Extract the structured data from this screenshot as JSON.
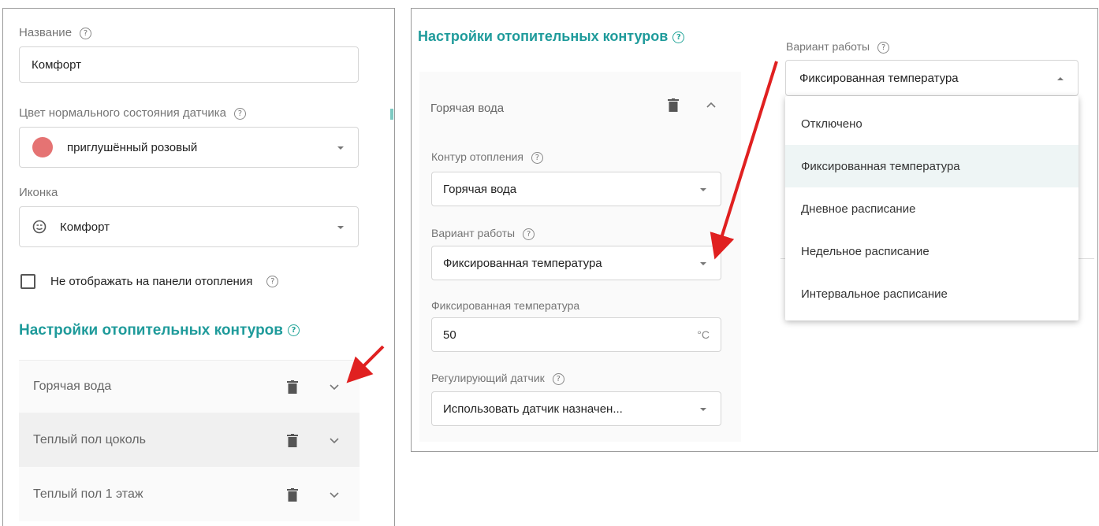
{
  "left": {
    "name_label": "Название",
    "name_value": "Комфорт",
    "color_label": "Цвет нормального состояния датчика",
    "color_value": "приглушённый розовый",
    "color_swatch": "#e57373",
    "icon_label": "Иконка",
    "icon_name": "smiley-icon",
    "icon_value": "Комфорт",
    "checkbox_label": "Не отображать на панели отопления",
    "section_title": "Настройки отопительных контуров",
    "circuits": [
      {
        "label": "Горячая вода"
      },
      {
        "label": "Теплый пол цоколь"
      },
      {
        "label": "Теплый пол 1 этаж"
      }
    ]
  },
  "right": {
    "section_title": "Настройки отопительных контуров",
    "circuit_title": "Горячая вода",
    "contour_label": "Контур отопления",
    "contour_value": "Горячая вода",
    "mode_label": "Вариант работы",
    "mode_value": "Фиксированная температура",
    "fixed_temp_label": "Фиксированная температура",
    "fixed_temp_value": "50",
    "fixed_temp_unit": "°C",
    "sensor_label": "Регулирующий датчик",
    "sensor_value": "Использовать датчик назначен...",
    "dropdown": {
      "label": "Вариант работы",
      "selected": "Фиксированная температура",
      "options": [
        "Отключено",
        "Фиксированная температура",
        "Дневное расписание",
        "Недельное расписание",
        "Интервальное расписание"
      ],
      "highlighted_index": 1
    }
  },
  "colors": {
    "accent": "#1f9b9b",
    "annotation_arrow": "#e02020",
    "highlight": "#eef5f5"
  }
}
